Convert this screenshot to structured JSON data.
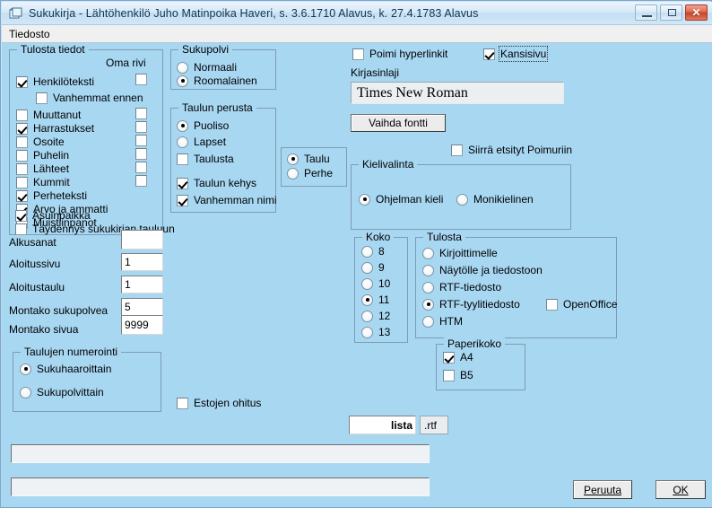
{
  "window": {
    "title": "Sukukirja - Lähtöhenkilö Juho Matinpoika Haveri,  s. 3.6.1710 Alavus, k. 27.4.1783 Alavus",
    "icon": "window-document-icon",
    "minimize_label": "–",
    "maximize_label": "□",
    "close_label": "✕"
  },
  "menubar": {
    "items": [
      {
        "label": "Tiedosto"
      }
    ]
  },
  "groups": {
    "tulosta_tiedot": {
      "title": "Tulosta tiedot",
      "column_header": "Oma rivi",
      "rows": [
        {
          "label": "Henkilöteksti",
          "checked": true,
          "own_row": false,
          "has_own_row": true
        },
        {
          "label": "Vanhemmat ennen",
          "checked": false,
          "own_row": false,
          "has_own_row": false,
          "indent": true
        },
        {
          "label": "Muuttanut",
          "checked": false,
          "own_row": false,
          "has_own_row": true
        },
        {
          "label": "Harrastukset",
          "checked": true,
          "own_row": false,
          "has_own_row": true
        },
        {
          "label": "Osoite",
          "checked": false,
          "own_row": false,
          "has_own_row": true
        },
        {
          "label": "Puhelin",
          "checked": false,
          "own_row": false,
          "has_own_row": true
        },
        {
          "label": "Lähteet",
          "checked": false,
          "own_row": false,
          "has_own_row": true
        },
        {
          "label": "Kummit",
          "checked": false,
          "own_row": false,
          "has_own_row": true
        },
        {
          "label": "Perheteksti",
          "checked": true,
          "own_row": false,
          "has_own_row": false
        },
        {
          "label": "Arvo ja ammatti",
          "checked": true,
          "own_row": false,
          "has_own_row": false
        },
        {
          "label": "Muistiinpanot",
          "checked": false,
          "own_row": false,
          "has_own_row": false
        },
        {
          "label": "Asuinpaikka",
          "checked": true,
          "own_row": false,
          "has_own_row": false
        },
        {
          "label": "Täydennys sukukirjan tauluun",
          "checked": false,
          "own_row": false,
          "has_own_row": false
        }
      ]
    },
    "sukupolvi": {
      "title": "Sukupolvi",
      "options": [
        {
          "label": "Normaali",
          "selected": false
        },
        {
          "label": "Roomalainen",
          "selected": true
        }
      ]
    },
    "taulun_perusta": {
      "title": "Taulun perusta",
      "radios": [
        {
          "label": "Puoliso",
          "selected": true
        },
        {
          "label": "Lapset",
          "selected": false
        }
      ],
      "checkboxes": [
        {
          "label": "Taulusta",
          "checked": false
        },
        {
          "label": "Taulun kehys",
          "checked": true
        },
        {
          "label": "Vanhemman nimi",
          "checked": true
        }
      ]
    },
    "taulu_perhe": {
      "options": [
        {
          "label": "Taulu",
          "selected": true
        },
        {
          "label": "Perhe",
          "selected": false
        }
      ]
    },
    "kielivalinta": {
      "title": "Kielivalinta",
      "options": [
        {
          "label": "Ohjelman kieli",
          "selected": true
        },
        {
          "label": "Monikielinen",
          "selected": false
        }
      ]
    },
    "koko": {
      "title": "Koko",
      "options": [
        {
          "label": "8",
          "selected": false
        },
        {
          "label": "9",
          "selected": false
        },
        {
          "label": "10",
          "selected": false
        },
        {
          "label": "11",
          "selected": true
        },
        {
          "label": "12",
          "selected": false
        },
        {
          "label": "13",
          "selected": false
        }
      ]
    },
    "tulosta": {
      "title": "Tulosta",
      "options": [
        {
          "label": "Kirjoittimelle",
          "selected": false
        },
        {
          "label": "Näytölle ja tiedostoon",
          "selected": false
        },
        {
          "label": "RTF-tiedosto",
          "selected": false
        },
        {
          "label": "RTF-tyylitiedosto",
          "selected": true
        },
        {
          "label": "HTM",
          "selected": false
        }
      ],
      "openoffice": {
        "label": "OpenOffice",
        "checked": false
      }
    },
    "paperikoko": {
      "title": "Paperikoko",
      "options": [
        {
          "label": "A4",
          "checked": true
        },
        {
          "label": "B5",
          "checked": false
        }
      ]
    },
    "taulujen_numerointi": {
      "title": "Taulujen numerointi",
      "options": [
        {
          "label": "Sukuhaaroittain",
          "selected": true
        },
        {
          "label": "Sukupolvittain",
          "selected": false
        }
      ]
    }
  },
  "top_right": {
    "poimi_hyperlinkit": {
      "label": "Poimi hyperlinkit",
      "checked": false
    },
    "kansisivu": {
      "label": "Kansisivu",
      "checked": true,
      "focused": true
    },
    "kirjasinlaji_label": "Kirjasinlaji",
    "font_value": "Times New Roman",
    "change_font_button": "Vaihda fontti",
    "siirra_etsityt": {
      "label": "Siirrä etsityt Poimuriin",
      "checked": false
    }
  },
  "fields": [
    {
      "label": "Alkusanat",
      "value": "",
      "align": "left"
    },
    {
      "label": "Aloitussivu",
      "value": "1",
      "align": "left"
    },
    {
      "label": "Aloitustaulu",
      "value": "1",
      "align": "left"
    },
    {
      "label": "Montako sukupolvea",
      "value": "5",
      "align": "left"
    },
    {
      "label": "Montako sivua",
      "value": "9999",
      "align": "left"
    }
  ],
  "estojen_ohitus": {
    "label": "Estojen ohitus",
    "checked": false
  },
  "filename": {
    "value": "lista",
    "extension": ".rtf"
  },
  "statusbars": [
    {
      "value": ""
    },
    {
      "value": ""
    }
  ],
  "buttons": {
    "cancel": {
      "label": "Peruuta",
      "accel": "P"
    },
    "ok": {
      "label": "OK",
      "accel": "O"
    }
  },
  "colors": {
    "client_bg": "#a8d7f2",
    "group_border": "#7e9cb3",
    "titlebar_text": "#12334f",
    "close_button": "#c7412a"
  }
}
